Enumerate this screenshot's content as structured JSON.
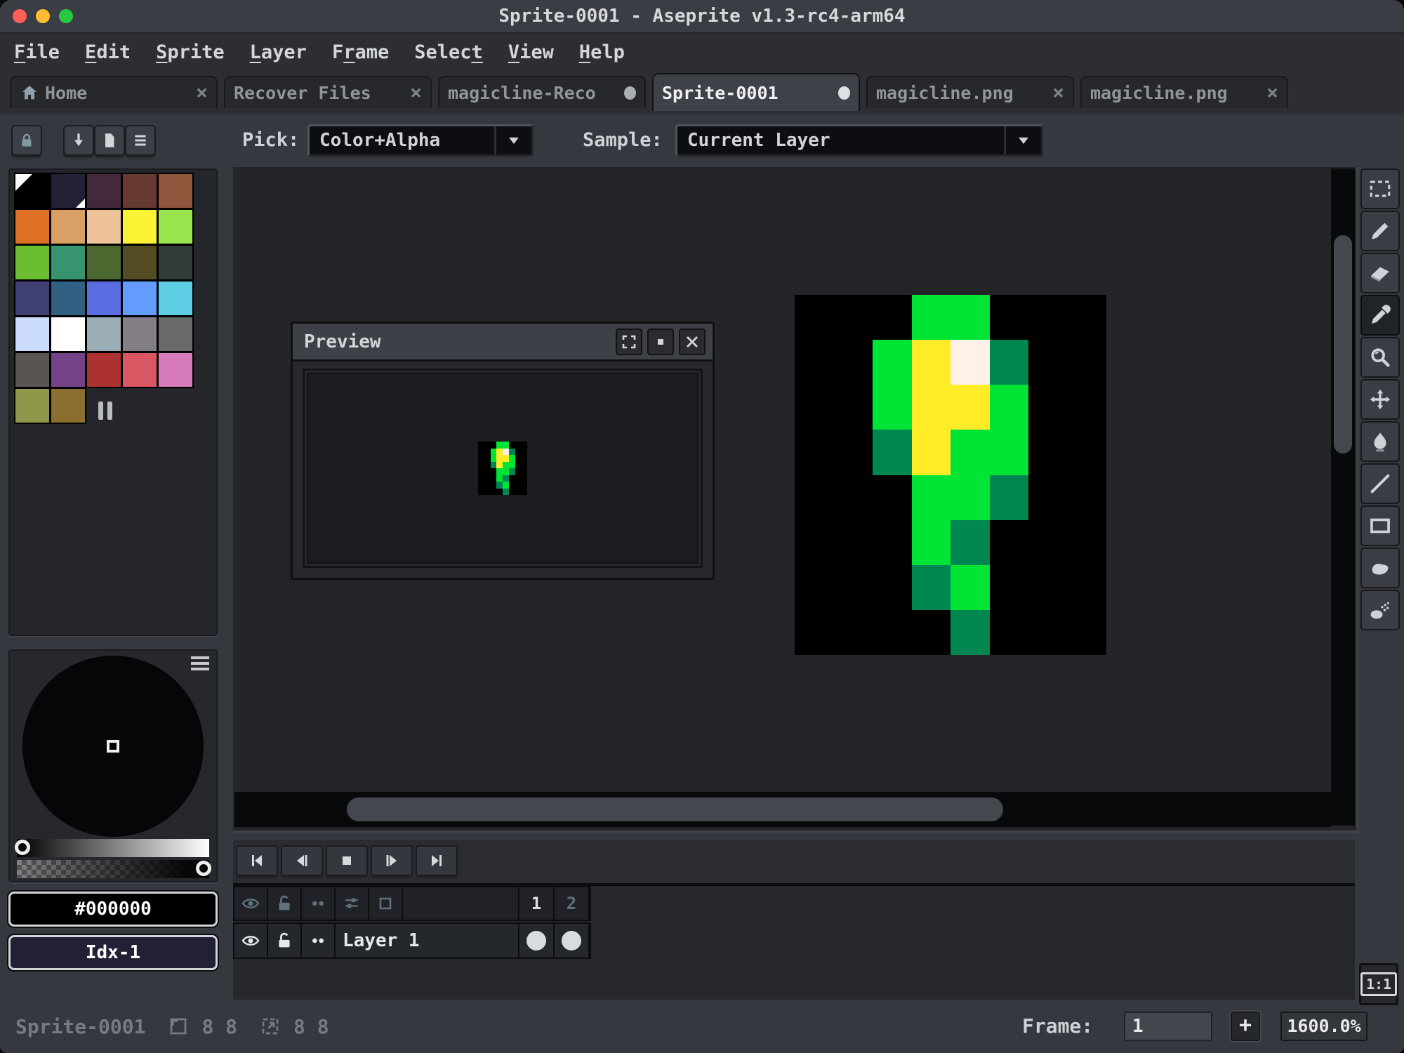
{
  "window": {
    "title": "Sprite-0001 - Aseprite v1.3-rc4-arm64"
  },
  "menu": {
    "items": [
      {
        "label": "File",
        "underline": 0
      },
      {
        "label": "Edit",
        "underline": 0
      },
      {
        "label": "Sprite",
        "underline": 0
      },
      {
        "label": "Layer",
        "underline": 0
      },
      {
        "label": "Frame",
        "underline": 1
      },
      {
        "label": "Select",
        "underline": 5
      },
      {
        "label": "View",
        "underline": 0
      },
      {
        "label": "Help",
        "underline": 0
      }
    ]
  },
  "tabs": [
    {
      "label": "Home",
      "icon": "home",
      "right": "close",
      "active": false
    },
    {
      "label": "Recover Files",
      "right": "close",
      "active": false
    },
    {
      "label": "magicline-Reco",
      "right": "dot",
      "active": false
    },
    {
      "label": "Sprite-0001",
      "right": "dot",
      "active": true
    },
    {
      "label": "magicline.png",
      "right": "close",
      "active": false
    },
    {
      "label": "magicline.png",
      "right": "close",
      "active": false
    }
  ],
  "context_bar": {
    "pick_label": "Pick:",
    "pick_value": "Color+Alpha",
    "sample_label": "Sample:",
    "sample_value": "Current Layer"
  },
  "palette": {
    "foreground_index": 0,
    "background_index": 1,
    "colors": [
      "#000000",
      "#222034",
      "#45283c",
      "#663931",
      "#8f563b",
      "#df7126",
      "#d9a066",
      "#eec39a",
      "#fbf236",
      "#99e550",
      "#6abe30",
      "#37946e",
      "#4b692f",
      "#524b24",
      "#323c39",
      "#3f3f74",
      "#306082",
      "#5b6ee1",
      "#639bff",
      "#5fcde4",
      "#cbdbfc",
      "#ffffff",
      "#9badb7",
      "#847e87",
      "#696a6a",
      "#595652",
      "#76428a",
      "#ac3232",
      "#d95763",
      "#d77bba",
      "#8f974a",
      "#8a6f30"
    ]
  },
  "color_selector": {
    "hex_value": "#000000",
    "index_value": "Idx-1"
  },
  "preview_window": {
    "title": "Preview"
  },
  "sprite": {
    "pixel_colors": {
      "K": "#000000",
      "G": "#00e436",
      "D": "#008751",
      "Y": "#ffec27",
      "W": "#fff1e8"
    },
    "pixels": [
      "KKKGGKKK",
      "KKGYWDKK",
      "KKGYYGKK",
      "KKDYGGKK",
      "KKKGGDKK",
      "KKKGDKKK",
      "KKKDGKKK",
      "KKKKDKKK"
    ]
  },
  "tools": [
    "rectangular-marquee",
    "pencil",
    "eraser",
    "eyedropper",
    "zoom",
    "move",
    "paint-bucket",
    "line",
    "rectangle",
    "contour",
    "spray"
  ],
  "active_tool": "eyedropper",
  "playback": [
    "go-to-first-frame",
    "previous-frame",
    "stop",
    "next-frame",
    "go-to-last-frame"
  ],
  "timeline": {
    "frames": [
      "1",
      "2"
    ],
    "current_frame_index": 0,
    "layers": [
      {
        "name": "Layer 1"
      }
    ]
  },
  "status_bar": {
    "sprite_name": "Sprite-0001",
    "canvas_size": "8 8",
    "selection_size": "8 8",
    "frame_label": "Frame:",
    "frame_value": "1",
    "add_frame": "+",
    "zoom_level": "1600.0%",
    "pixel_ratio": "1:1"
  }
}
